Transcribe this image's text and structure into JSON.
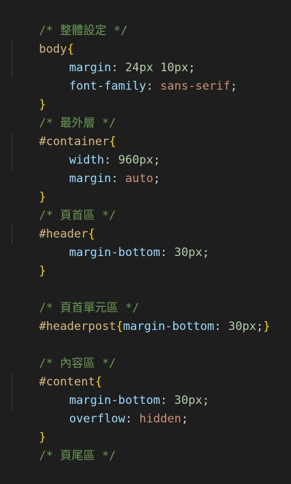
{
  "editor": {
    "theme": {
      "background": "#1e1e1e",
      "comment": "#6a9955",
      "selector": "#d7ba7d",
      "brace": "#ffd700",
      "property": "#9cdcfe",
      "number": "#b5cea8",
      "string_value": "#ce9178",
      "punctuation": "#d4d4d4"
    },
    "lines": [
      {
        "kind": "comment",
        "text": "/* 整體設定 */"
      },
      {
        "kind": "selector_open",
        "selector": "body",
        "brace": "{"
      },
      {
        "kind": "decl",
        "prop": "margin",
        "value": "24px 10px",
        "value_type": "num"
      },
      {
        "kind": "decl",
        "prop": "font-family",
        "value": "sans-serif",
        "value_type": "val"
      },
      {
        "kind": "close",
        "brace": "}"
      },
      {
        "kind": "comment",
        "text": "/* 最外層 */"
      },
      {
        "kind": "selector_open",
        "selector": "#container",
        "brace": "{"
      },
      {
        "kind": "decl",
        "prop": "width",
        "value": "960px",
        "value_type": "num"
      },
      {
        "kind": "decl",
        "prop": "margin",
        "value": "auto",
        "value_type": "val"
      },
      {
        "kind": "close",
        "brace": "}"
      },
      {
        "kind": "comment",
        "text": "/* 頁首區 */"
      },
      {
        "kind": "selector_open",
        "selector": "#header",
        "brace": "{"
      },
      {
        "kind": "decl",
        "prop": "margin-bottom",
        "value": "30px",
        "value_type": "num"
      },
      {
        "kind": "close",
        "brace": "}"
      },
      {
        "kind": "blank"
      },
      {
        "kind": "comment",
        "text": "/* 頁首單元區 */"
      },
      {
        "kind": "inline",
        "selector": "#headerpost",
        "brace_open": "{",
        "prop": "margin-bottom",
        "value": "30px",
        "value_type": "num",
        "brace_close": "}"
      },
      {
        "kind": "blank"
      },
      {
        "kind": "comment",
        "text": "/* 內容區 */"
      },
      {
        "kind": "selector_open",
        "selector": "#content",
        "brace": "{"
      },
      {
        "kind": "decl",
        "prop": "margin-bottom",
        "value": "30px",
        "value_type": "num"
      },
      {
        "kind": "decl",
        "prop": "overflow",
        "value": "hidden",
        "value_type": "val"
      },
      {
        "kind": "close",
        "brace": "}"
      },
      {
        "kind": "comment",
        "text": "/* 頁尾區 */"
      }
    ]
  }
}
